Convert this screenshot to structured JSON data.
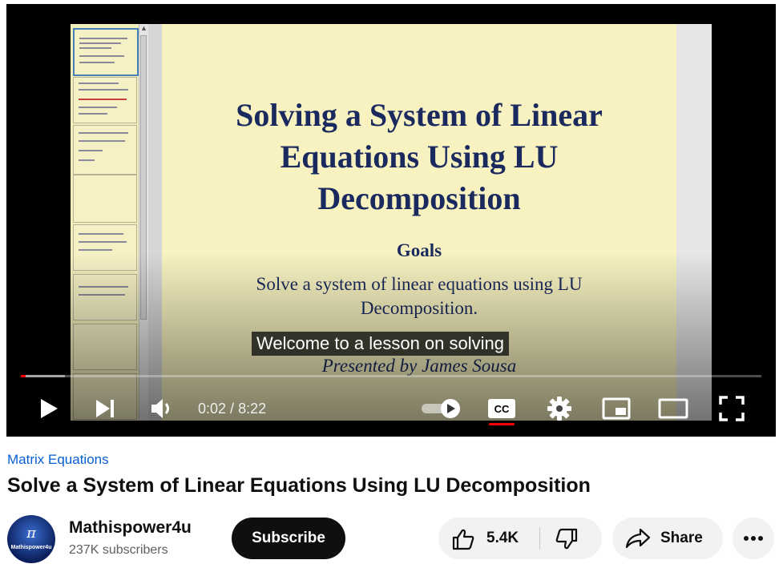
{
  "slide": {
    "title_lines": [
      "Solving a System of Linear",
      "Equations Using LU",
      "Decomposition"
    ],
    "goals_heading": "Goals",
    "goal_lines": [
      "Solve a system of linear equations using LU",
      "Decomposition."
    ],
    "presenter": "Presented by James Sousa"
  },
  "player": {
    "caption": "Welcome to a lesson on solving",
    "current_time": "0:02",
    "duration": "8:22",
    "time_separator": " / ",
    "progress": {
      "played_fraction": 0.006,
      "buffered_fraction": 0.06
    },
    "captions_enabled": true,
    "autoplay_on": true
  },
  "video": {
    "playlist": "Matrix Equations",
    "title": "Solve a System of Linear Equations Using LU Decomposition"
  },
  "channel": {
    "name": "Mathispower4u",
    "subscribers": "237K subscribers",
    "avatar_symbol": "π",
    "avatar_brand": "Mathispower4u"
  },
  "actions": {
    "subscribe": "Subscribe",
    "likes": "5.4K",
    "share": "Share"
  },
  "icons": {
    "play": "play-icon",
    "next": "skip-next-icon",
    "volume": "volume-icon",
    "autoplay": "autoplay-toggle-icon",
    "cc": "closed-captions-icon",
    "settings": "gear-icon",
    "miniplayer": "miniplayer-icon",
    "theater": "theater-mode-icon",
    "fullscreen": "fullscreen-icon",
    "like": "thumbs-up-icon",
    "dislike": "thumbs-down-icon",
    "share": "share-arrow-icon",
    "more": "more-horizontal-icon"
  },
  "colors": {
    "progress_played": "#ff0000",
    "link": "#065fd4",
    "slide_background": "#f7f2c0",
    "slide_text": "#1b2a5e",
    "button_dark": "#0f0f0f",
    "button_light": "#f2f2f2"
  }
}
